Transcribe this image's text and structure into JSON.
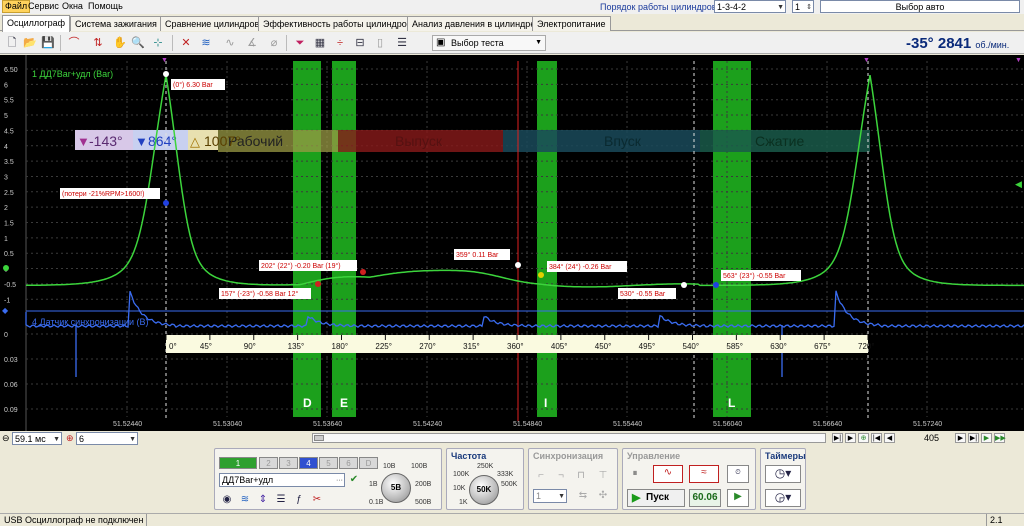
{
  "menu": {
    "items": [
      "Файл",
      "Сервис",
      "Окна",
      "Помощь"
    ]
  },
  "order": {
    "label": "Порядок работы цилиндров",
    "value": "1-3-4-2",
    "cyl_value": "1",
    "car_value": "Выбор авто"
  },
  "tabs": [
    "Осциллограф",
    "Система зажигания",
    "Сравнение цилиндров",
    "Эффективность работы цилиндров",
    "Анализ давления в цилиндре",
    "Электропитание"
  ],
  "toolbar": {
    "test_select": "Выбор теста",
    "rpm_angle": "-35°",
    "rpm_value": "2841",
    "rpm_unit": "об./мин."
  },
  "scope": {
    "ch1_label": "1 ДД7Bar+удл (Bar)",
    "ch4_label": "4 Датчик синхронизации (В)",
    "y1_ticks": [
      "6.50",
      "6",
      "5.5",
      "5",
      "4.5",
      "4",
      "3.5",
      "3",
      "2.5",
      "2",
      "1.5",
      "1",
      "0.5",
      "0",
      "-0.5",
      "-1"
    ],
    "y4_ticks": [
      "0",
      "0.03",
      "0.06",
      "0.09"
    ],
    "x_ticks": [
      "51.52440",
      "51.53040",
      "51.53640",
      "51.54240",
      "51.54840",
      "51.55440",
      "51.56040",
      "51.56640",
      "51.57240"
    ],
    "deg_ticks": [
      "0°",
      "45°",
      "90°",
      "135°",
      "180°",
      "225°",
      "270°",
      "315°",
      "360°",
      "405°",
      "450°",
      "495°",
      "540°",
      "585°",
      "630°",
      "675°",
      "720°"
    ],
    "phases": [
      "Рабочий",
      "Выпуск",
      "Впуск",
      "Сжатие"
    ],
    "cursor1": "-143°",
    "cursor2": "864°",
    "delta": "1007°",
    "zones": [
      "D",
      "E",
      "I",
      "L"
    ],
    "annotations": {
      "peak": "(0°) 6.30 Bar",
      "loss": "(потери -21%RPM>1600!)",
      "a202": "202° (22°) -0.20 Bar (19°)",
      "a157": "157° (-23°) -0.58 Bar 12°",
      "a359": "359° 0.11 Bar",
      "a384": "384° (24°) -0.26 Bar",
      "a530": "530° -0.55 Bar",
      "a563": "563° (23°) -0.55 Bar"
    }
  },
  "bottom": {
    "time_value": "59.1 мс",
    "ch_value": "6",
    "frame_value": "405"
  },
  "controls": {
    "channels": [
      "1",
      "2",
      "3",
      "4",
      "5",
      "6",
      "D"
    ],
    "channel_name": "ДД7Bar+удл",
    "freq_title": "Частота",
    "freq_value": "50K",
    "freq_ticks": [
      "100K",
      "250K",
      "333K",
      "500K",
      "1K",
      "10K"
    ],
    "sync_title": "Синхронизация",
    "sync_value": "1",
    "control_title": "Управление",
    "start_label": "Пуск",
    "fps_value": "60.06",
    "timers_title": "Таймеры",
    "volt_value": "5В",
    "volt_ticks": [
      "10В",
      "100В",
      "1В",
      "200В",
      "0.1В",
      "500В"
    ]
  },
  "status": {
    "left": "USB Осциллограф не подключен",
    "right": "2.1"
  },
  "colors": {
    "green_trace": "#3cd43c",
    "blue_trace": "#3a6cf0",
    "zone_green": "#1ca01c",
    "scope_bg": "#000000"
  }
}
